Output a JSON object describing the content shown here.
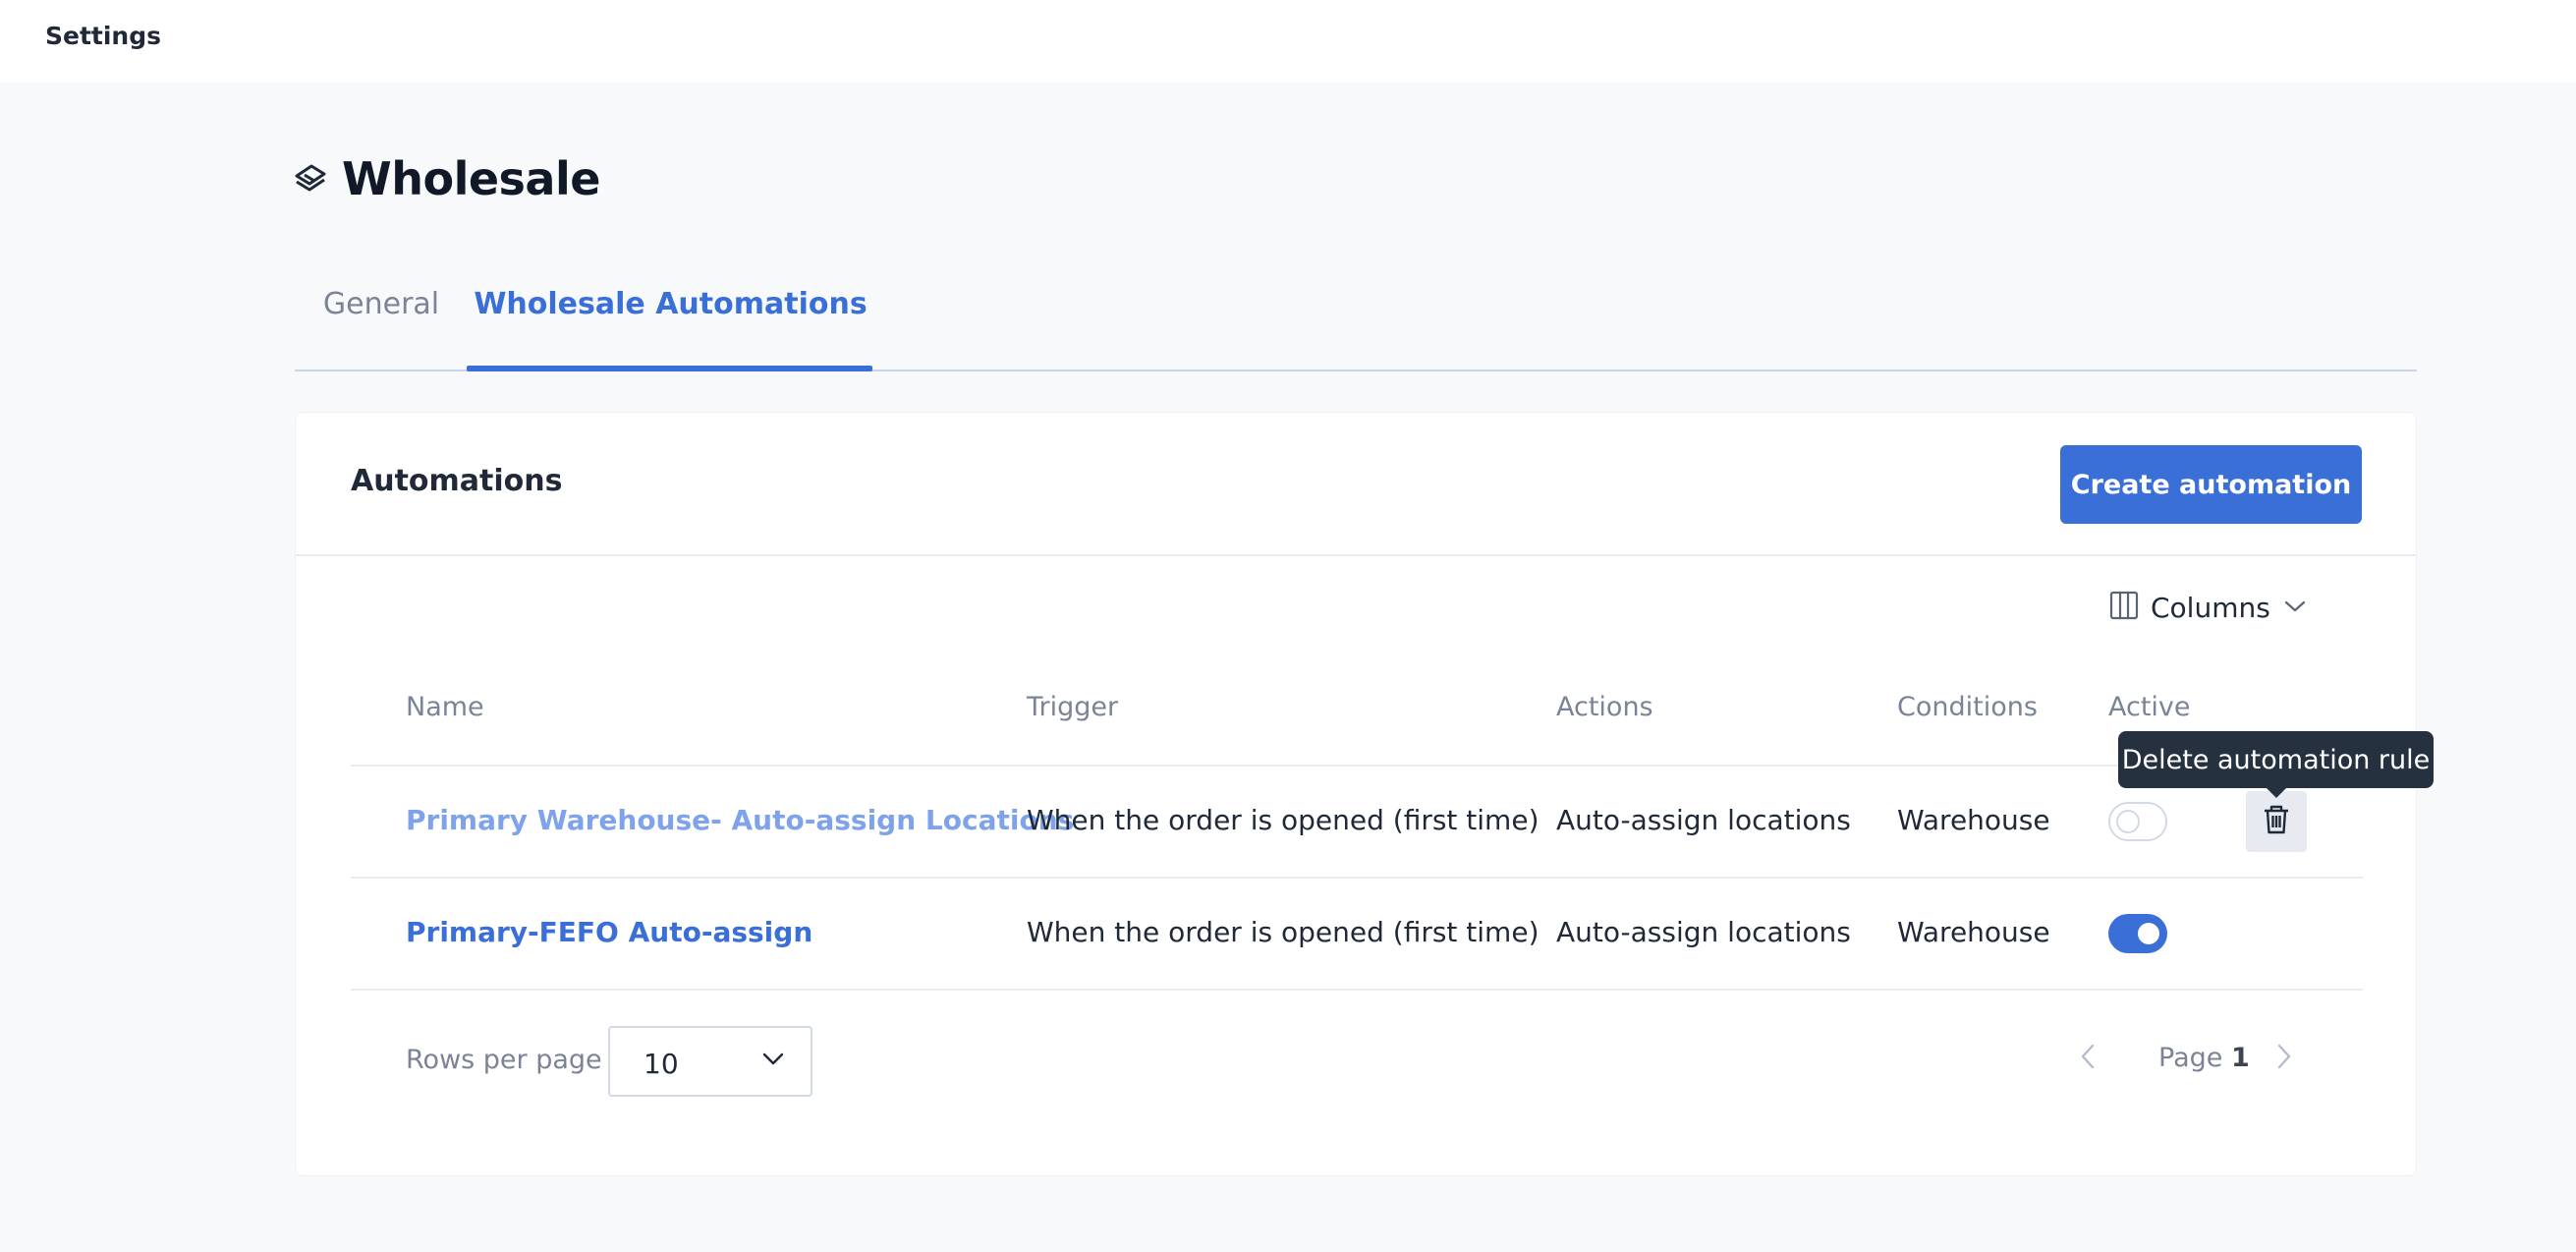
{
  "topbar": {
    "title": "Settings"
  },
  "page": {
    "title": "Wholesale",
    "icon": "stacked-layers-icon"
  },
  "tabs": [
    {
      "label": "General",
      "active": false
    },
    {
      "label": "Wholesale Automations",
      "active": true
    }
  ],
  "card": {
    "title": "Automations",
    "create_button": "Create automation",
    "columns_button": "Columns"
  },
  "table": {
    "headers": {
      "name": "Name",
      "trigger": "Trigger",
      "actions": "Actions",
      "conditions": "Conditions",
      "active": "Active"
    },
    "rows": [
      {
        "name": "Primary Warehouse- Auto-assign Locations",
        "trigger": "When the order is opened (first time)",
        "actions": "Auto-assign locations",
        "conditions": "Warehouse",
        "active": false
      },
      {
        "name": "Primary-FEFO Auto-assign",
        "trigger": "When the order is opened (first time)",
        "actions": "Auto-assign locations",
        "conditions": "Warehouse",
        "active": true
      }
    ]
  },
  "tooltip": {
    "text": "Delete automation rule"
  },
  "pagination": {
    "rows_per_page_label": "Rows per page",
    "rows_per_page_value": "10",
    "page_label": "Page",
    "page_number": "1"
  },
  "colors": {
    "accent": "#3a6fd8",
    "tooltip_bg": "#263140",
    "muted_text": "#7b8496"
  }
}
